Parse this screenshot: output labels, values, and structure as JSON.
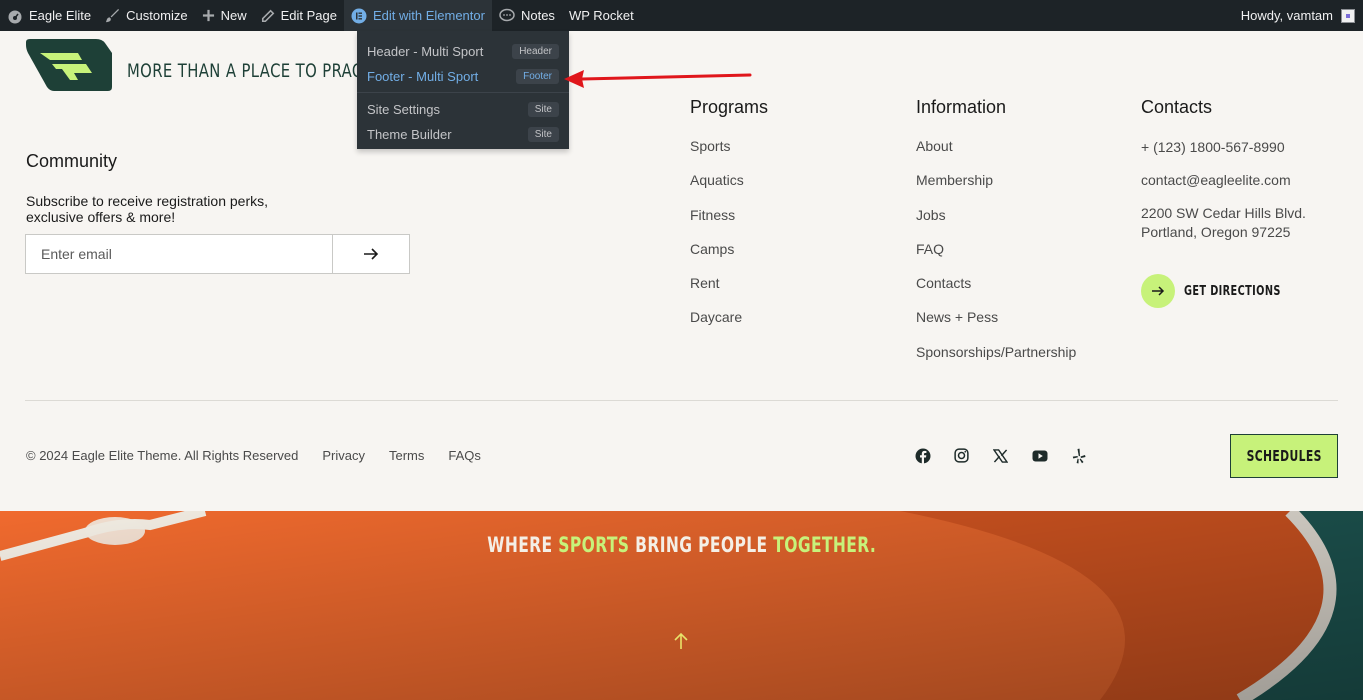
{
  "adminbar": {
    "site_name": "Eagle Elite",
    "customize": "Customize",
    "new": "New",
    "edit_page": "Edit Page",
    "edit_elementor": "Edit with Elementor",
    "notes": "Notes",
    "wp_rocket": "WP Rocket",
    "howdy": "Howdy, vamtam"
  },
  "elementor_menu": {
    "items": [
      {
        "label": "Header - Multi Sport",
        "badge": "Header"
      },
      {
        "label": "Footer - Multi Sport",
        "badge": "Footer"
      },
      {
        "label": "Site Settings",
        "badge": "Site"
      },
      {
        "label": "Theme Builder",
        "badge": "Site"
      }
    ]
  },
  "footer": {
    "tagline": "MORE THAN A PLACE TO PRACT",
    "community": {
      "title": "Community",
      "text": "Subscribe to receive registration perks, exclusive offers & more!",
      "email_placeholder": "Enter email"
    },
    "programs": {
      "title": "Programs",
      "links": [
        "Sports",
        "Aquatics",
        "Fitness",
        "Camps",
        "Rent",
        "Daycare"
      ]
    },
    "information": {
      "title": "Information",
      "links": [
        "About",
        "Membership",
        "Jobs",
        "FAQ",
        "Contacts",
        "News + Pess",
        "Sponsorships/Partnership"
      ]
    },
    "contacts": {
      "title": "Contacts",
      "phone": "+ (123) 1800-567-8990",
      "email": "contact@eagleelite.com",
      "address_line1": "2200 SW Cedar Hills Blvd.",
      "address_line2": "Portland, Oregon 97225",
      "directions": "GET DIRECTIONS"
    },
    "bottom": {
      "copyright": "© 2024 Eagle Elite Theme. All Rights Reserved",
      "privacy": "Privacy",
      "terms": "Terms",
      "faqs": "FAQs",
      "schedules": "SCHEDULES"
    },
    "socials": [
      "facebook-icon",
      "instagram-icon",
      "x-icon",
      "youtube-icon",
      "yelp-icon"
    ]
  },
  "court": {
    "word1": "WHERE ",
    "word2": "SPORTS",
    "word3": " BRING PEOPLE ",
    "word4": "TOGETHER."
  },
  "colors": {
    "accent_green": "#c7f27a",
    "dark_green": "#1e4037",
    "court_orange": "#f06a2e",
    "admin_bar": "#1d2327",
    "admin_link_blue": "#72aee6"
  }
}
